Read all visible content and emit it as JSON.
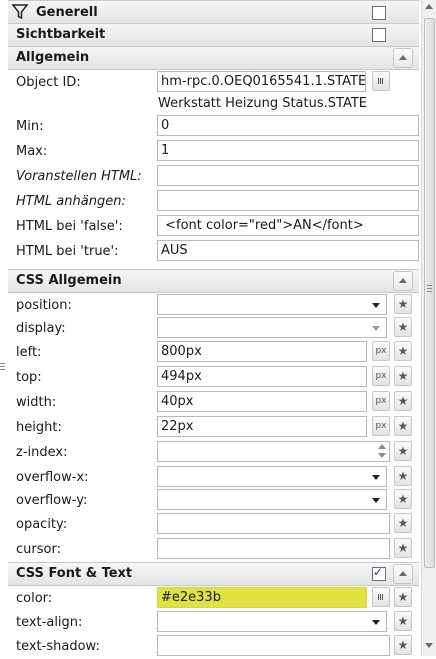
{
  "sections": {
    "generell": "Generell",
    "sichtbarkeit": "Sichtbarkeit",
    "allgemein": "Allgemein",
    "css_allgemein": "CSS Allgemein",
    "css_font_text": "CSS Font & Text"
  },
  "allgemein": {
    "object_id_label": "Object ID:",
    "object_id_value": "hm-rpc.0.OEQ0165541.1.STATE",
    "object_id_desc": "Werkstatt Heizung Status.STATE",
    "min_label": "Min:",
    "min_value": "0",
    "max_label": "Max:",
    "max_value": "1",
    "prepend_label": "Voranstellen HTML:",
    "prepend_value": "",
    "append_label": "HTML anhängen:",
    "append_value": "",
    "false_label": "HTML bei 'false':",
    "false_value": " <font color=\"red\">AN</font>",
    "true_label": "HTML bei 'true':",
    "true_value": "AUS"
  },
  "css": {
    "position_label": "position:",
    "position_value": "",
    "display_label": "display:",
    "display_value": "",
    "left_label": "left:",
    "left_value": "800px",
    "top_label": "top:",
    "top_value": "494px",
    "width_label": "width:",
    "width_value": "40px",
    "height_label": "height:",
    "height_value": "22px",
    "zindex_label": "z-index:",
    "zindex_value": "",
    "overflowx_label": "overflow-x:",
    "overflowx_value": "",
    "overflowy_label": "overflow-y:",
    "overflowy_value": "",
    "opacity_label": "opacity:",
    "opacity_value": "",
    "cursor_label": "cursor:",
    "cursor_value": ""
  },
  "font": {
    "color_label": "color:",
    "color_value": "#e2e33b",
    "textalign_label": "text-align:",
    "textalign_value": "",
    "textshadow_label": "text-shadow:",
    "textshadow_value": ""
  },
  "units": {
    "px": "px"
  },
  "colors": {
    "highlight": "#e1e140"
  },
  "checkboxes": {
    "generell": false,
    "sichtbarkeit": false,
    "css_font_text": true
  }
}
